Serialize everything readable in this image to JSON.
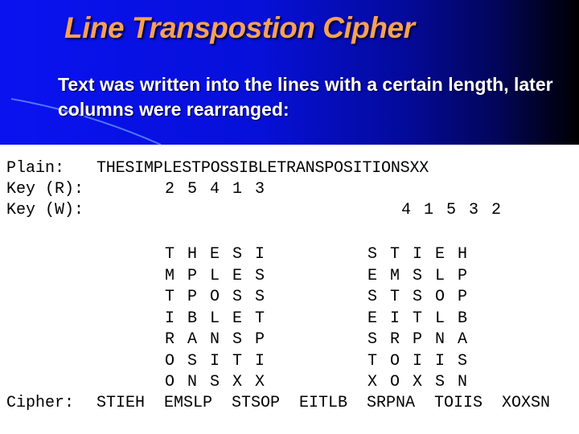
{
  "slide": {
    "title": "Line Transpostion Cipher",
    "subtitle": "Text was written into the lines with a certain length, later columns were rearranged:",
    "colors": {
      "title": "#f7a155",
      "subtitle": "#ffffff",
      "header_bg_start": "#0a12f0",
      "header_bg_end": "#000000",
      "body_bg": "#ffffff",
      "text": "#000000"
    }
  },
  "cipher_demo": {
    "plain_label": "Plain:",
    "plain_text": "THESIMPLESTPOSSIBLETRANSPOSITIONSXX",
    "key_read_label": "Key (R):",
    "key_read": [
      "2",
      "5",
      "4",
      "1",
      "3"
    ],
    "key_write_label": "Key (W):",
    "key_write": [
      "4",
      "1",
      "5",
      "3",
      "2"
    ],
    "left_grid": [
      [
        "T",
        "H",
        "E",
        "S",
        "I"
      ],
      [
        "M",
        "P",
        "L",
        "E",
        "S"
      ],
      [
        "T",
        "P",
        "O",
        "S",
        "S"
      ],
      [
        "I",
        "B",
        "L",
        "E",
        "T"
      ],
      [
        "R",
        "A",
        "N",
        "S",
        "P"
      ],
      [
        "O",
        "S",
        "I",
        "T",
        "I"
      ],
      [
        "O",
        "N",
        "S",
        "X",
        "X"
      ]
    ],
    "right_grid": [
      [
        "S",
        "T",
        "I",
        "E",
        "H"
      ],
      [
        "E",
        "M",
        "S",
        "L",
        "P"
      ],
      [
        "S",
        "T",
        "S",
        "O",
        "P"
      ],
      [
        "E",
        "I",
        "T",
        "L",
        "B"
      ],
      [
        "S",
        "R",
        "P",
        "N",
        "A"
      ],
      [
        "T",
        "O",
        "I",
        "I",
        "S"
      ],
      [
        "X",
        "O",
        "X",
        "S",
        "N"
      ]
    ],
    "cipher_label": "Cipher:",
    "cipher_groups": [
      "STIEH",
      "EMSLP",
      "STSOP",
      "EITLB",
      "SRPNA",
      "TOIIS",
      "XOXSN"
    ]
  }
}
